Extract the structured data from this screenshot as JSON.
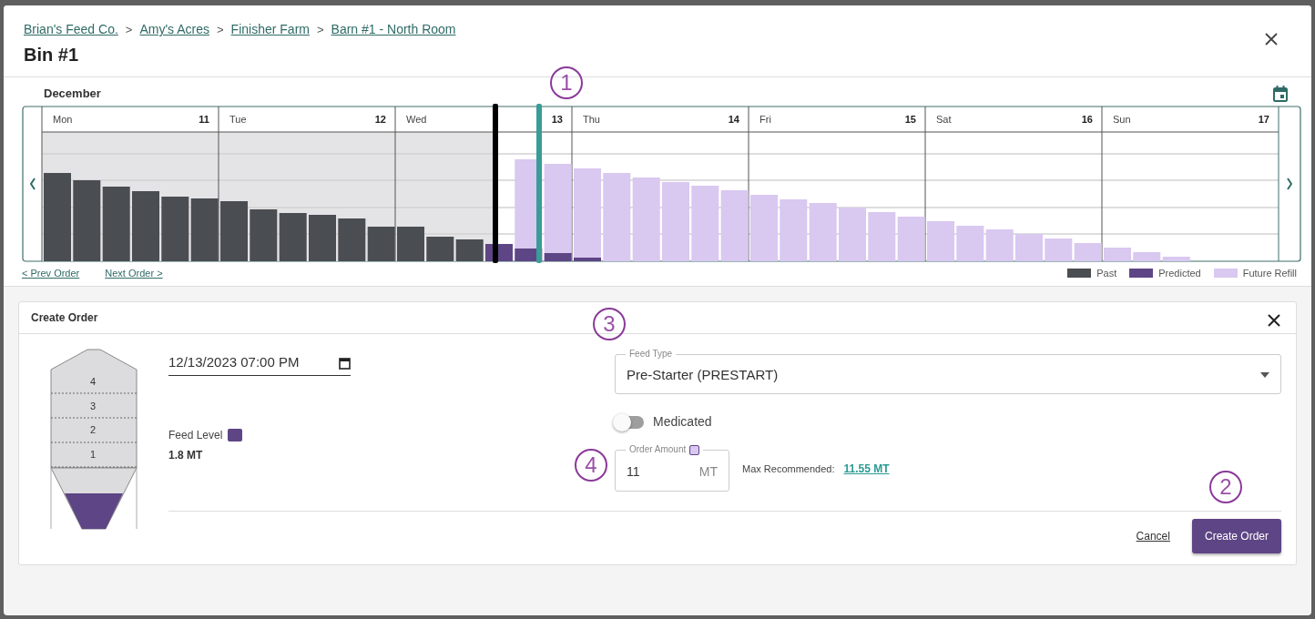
{
  "breadcrumbs": [
    {
      "label": "Brian's Feed Co."
    },
    {
      "label": "Amy's Acres"
    },
    {
      "label": "Finisher Farm"
    },
    {
      "label": "Barn #1 - North Room"
    }
  ],
  "breadcrumb_separator": ">",
  "title": "Bin #1",
  "chart": {
    "month": "December",
    "days": [
      {
        "weekday": "Mon",
        "date": "11"
      },
      {
        "weekday": "Tue",
        "date": "12"
      },
      {
        "weekday": "Wed",
        "date": "13"
      },
      {
        "weekday": "Thu",
        "date": "14"
      },
      {
        "weekday": "Fri",
        "date": "15"
      },
      {
        "weekday": "Sat",
        "date": "16"
      },
      {
        "weekday": "Sun",
        "date": "17"
      }
    ],
    "prev_link": "< Prev Order",
    "next_link": "Next Order >",
    "legend": [
      {
        "label": "Past",
        "color": "#4a4d52"
      },
      {
        "label": "Predicted",
        "color": "#5e4585"
      },
      {
        "label": "Future Refill",
        "color": "#d9c8f0"
      }
    ]
  },
  "callouts": [
    "1",
    "3",
    "4",
    "2"
  ],
  "order": {
    "title": "Create Order",
    "silo_sections": [
      "4",
      "3",
      "2",
      "1"
    ],
    "date_value": "12/13/2023 07:00 PM",
    "feed_level_label": "Feed Level",
    "feed_level_value": "1.8 MT",
    "feed_type": {
      "label": "Feed Type",
      "value": "Pre-Starter (PRESTART)"
    },
    "medicated": {
      "label": "Medicated",
      "on": false
    },
    "order_amount": {
      "label": "Order Amount",
      "value": "11",
      "unit": "MT"
    },
    "max_recommended": {
      "label": "Max Recommended:",
      "value": "11.55 MT"
    },
    "cancel": "Cancel",
    "submit": "Create Order"
  }
}
